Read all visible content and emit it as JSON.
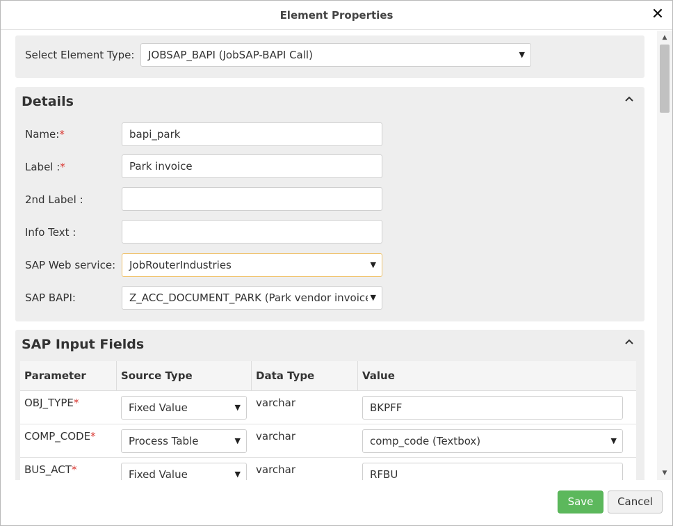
{
  "dialog": {
    "title": "Element Properties",
    "close_glyph": "✕"
  },
  "element_type": {
    "label": "Select Element Type:",
    "selected": "JOBSAP_BAPI (JobSAP-BAPI Call)"
  },
  "details": {
    "heading": "Details",
    "fields": {
      "name": {
        "label": "Name:",
        "required_mark": "*",
        "value": "bapi_park"
      },
      "label": {
        "label": "Label :",
        "required_mark": "*",
        "value": "Park invoice"
      },
      "second_label": {
        "label": "2nd Label :",
        "value": ""
      },
      "info_text": {
        "label": "Info Text :",
        "value": ""
      },
      "web_service": {
        "label": "SAP Web service:",
        "selected": "JobRouterIndustries"
      },
      "bapi": {
        "label": "SAP BAPI:",
        "selected": "Z_ACC_DOCUMENT_PARK (Park vendor invoice)"
      }
    }
  },
  "sap_input": {
    "heading": "SAP Input Fields",
    "columns": [
      "Parameter",
      "Source Type",
      "Data Type",
      "Value"
    ],
    "rows": [
      {
        "parameter": "OBJ_TYPE",
        "required_mark": "*",
        "source_type": "Fixed Value",
        "data_type": "varchar",
        "value": "BKPFF",
        "value_kind": "input"
      },
      {
        "parameter": "COMP_CODE",
        "required_mark": "*",
        "source_type": "Process Table",
        "data_type": "varchar",
        "value": "comp_code (Textbox)",
        "value_kind": "select"
      },
      {
        "parameter": "BUS_ACT",
        "required_mark": "*",
        "source_type": "Fixed Value",
        "data_type": "varchar",
        "value": "RFBU",
        "value_kind": "input"
      }
    ]
  },
  "footer": {
    "save_label": "Save",
    "cancel_label": "Cancel"
  },
  "icons": {
    "caret": "▼",
    "collapse": "chevron-up-icon",
    "scroll_up": "▲",
    "scroll_down": "▼"
  },
  "colors": {
    "save": "#5cb85c",
    "required": "#d9352f",
    "panel": "#eeeeee",
    "focus_border": "#f0c36d"
  }
}
